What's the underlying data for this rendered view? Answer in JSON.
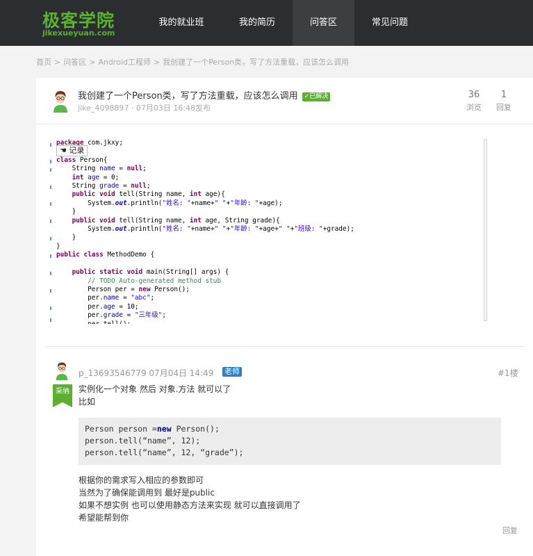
{
  "site": {
    "logo_cn": "极客学院",
    "logo_en": "jikexueyuan.com",
    "brand_color": "#5cb030",
    "nav": [
      "我的就业班",
      "我的简历",
      "问答区",
      "常见问题"
    ],
    "active_nav": "问答区"
  },
  "breadcrumb": [
    "首页",
    "问答区",
    "Android工程师",
    "我创建了一个Person类，写了方法重载，应该怎么调用"
  ],
  "breadcrumb_separator": ">",
  "question": {
    "title": "我创建了一个Person类，写了方法重载，应该怎么调用",
    "status_badge": "已解决",
    "meta": "jike_4098897 · 07月03日 16:48发布",
    "views": "36",
    "views_label": "浏览",
    "replies": "1",
    "replies_label": "回复",
    "record_tooltip": "记录",
    "code_lines": [
      "package com.jkxy;",
      "",
      "class Person{",
      "    String name = null;",
      "    int age = 0;",
      "    String grade = null;",
      "    public void tell(String name, int age){",
      "        System.out.println(\"姓名: \"+name+\" \"+\"年龄: \"+age);",
      "    }",
      "    public void tell(String name, int age, String grade){",
      "        System.out.println(\"姓名: \"+name+\" \"+\"年龄: \"+age+\" \"+\"班级: \"+grade);",
      "    }",
      "}",
      "public class MethodDemo {",
      "",
      "    public static void main(String[] args) {",
      "        // TODO Auto-generated method stub",
      "        Person per = new Person();",
      "        per.name = \"abc\";",
      "        per.age = 10;",
      "        per.grade = \"三年级\";",
      "        per.tell();"
    ]
  },
  "answer": {
    "author_line": "p_13693546779 07月04日 14:49",
    "role_badge": "老师",
    "floor": "#1楼",
    "accepted_label": "采纳",
    "intro_lines": [
      "实例化一个对象 然后 对象.方法 就可以了",
      "比如"
    ],
    "code_lines": [
      "Person person =new Person();",
      "person.tell(“name”, 12);",
      "person.tell(“name”, 12, “grade”);"
    ],
    "outro_lines": [
      "根据你的需求写入相应的参数即可",
      "当然为了确保能调用到 最好是public",
      "如果不想实例 也可以使用静态方法来实现 就可以直接调用了",
      "希望能帮到你"
    ],
    "reply_label": "回复"
  }
}
